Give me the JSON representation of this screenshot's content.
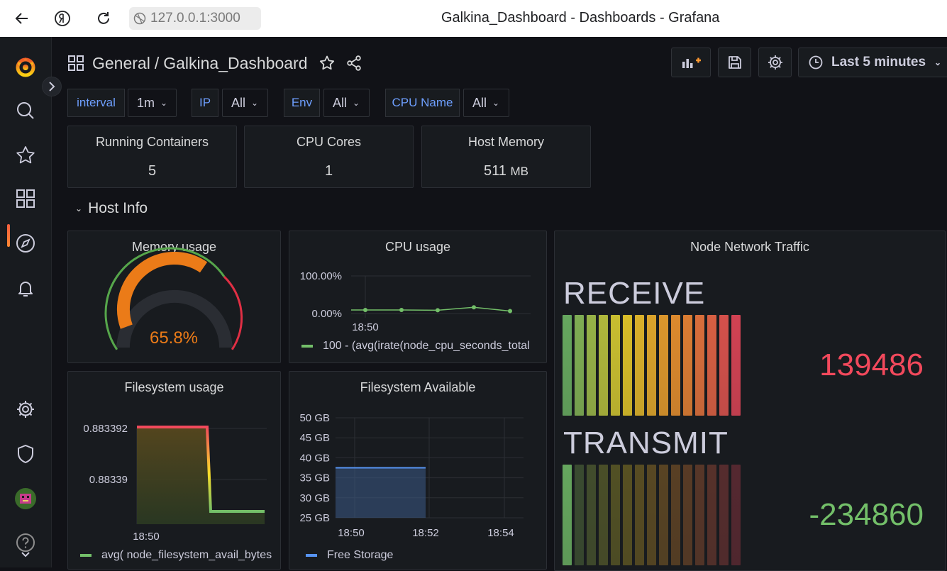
{
  "browser": {
    "url": "127.0.0.1:3000",
    "window_title": "Galkina_Dashboard - Dashboards - Grafana"
  },
  "topbar": {
    "breadcrumb_root": "General",
    "breadcrumb_sep": "/",
    "dashboard_name": "Galkina_Dashboard",
    "time_range": "Last 5 minutes"
  },
  "variables": [
    {
      "label": "interval",
      "value": "1m"
    },
    {
      "label": "IP",
      "value": "All"
    },
    {
      "label": "Env",
      "value": "All"
    },
    {
      "label": "CPU Name",
      "value": "All"
    }
  ],
  "stats": [
    {
      "title": "Running Containers",
      "value": "5",
      "unit": ""
    },
    {
      "title": "CPU Cores",
      "value": "1",
      "unit": ""
    },
    {
      "title": "Host Memory",
      "value": "511",
      "unit": "MB"
    }
  ],
  "row": {
    "title": "Host Info"
  },
  "memory": {
    "title": "Memory usage",
    "value_text": "65.8%",
    "value": 65.8,
    "color": "#eb7b18"
  },
  "cpu": {
    "title": "CPU usage",
    "y_ticks": [
      "100.00%",
      "0.00%"
    ],
    "x_ticks": [
      "18:50"
    ],
    "legend": "100 - (avg(irate(node_cpu_seconds_total",
    "color": "#73bf69"
  },
  "network": {
    "title": "Node Network Traffic",
    "receive_label": "RECEIVE",
    "receive_value": "139486",
    "receive_color": "#f2495c",
    "transmit_label": "TRANSMIT",
    "transmit_value": "-234860",
    "transmit_color": "#73bf69"
  },
  "fs_usage": {
    "title": "Filesystem usage",
    "y_ticks": [
      "0.883392",
      "0.88339"
    ],
    "x_ticks": [
      "18:50"
    ],
    "legend": "avg( node_filesystem_avail_bytes",
    "color": "#73bf69"
  },
  "fs_avail": {
    "title": "Filesystem Available",
    "y_ticks": [
      "50 GB",
      "45 GB",
      "40 GB",
      "35 GB",
      "30 GB",
      "25 GB"
    ],
    "x_ticks": [
      "18:50",
      "18:52",
      "18:54"
    ],
    "legend": "Free Storage",
    "color": "#5794f2"
  },
  "chart_data": [
    {
      "type": "line",
      "title": "CPU usage",
      "ylim": [
        0,
        100
      ],
      "series": [
        {
          "name": "100 - (avg(irate(node_cpu_seconds_total",
          "values": [
            17,
            17,
            16,
            30,
            12
          ]
        }
      ]
    },
    {
      "type": "line",
      "title": "Filesystem usage",
      "series": [
        {
          "name": "avg( node_filesystem_avail_bytes",
          "values": [
            0.883392,
            0.883392,
            0.88339,
            0.88339
          ]
        }
      ]
    },
    {
      "type": "area",
      "title": "Filesystem Available",
      "ylim": [
        25,
        50
      ],
      "series": [
        {
          "name": "Free Storage",
          "values": [
            37.5,
            37.5
          ]
        }
      ]
    }
  ]
}
